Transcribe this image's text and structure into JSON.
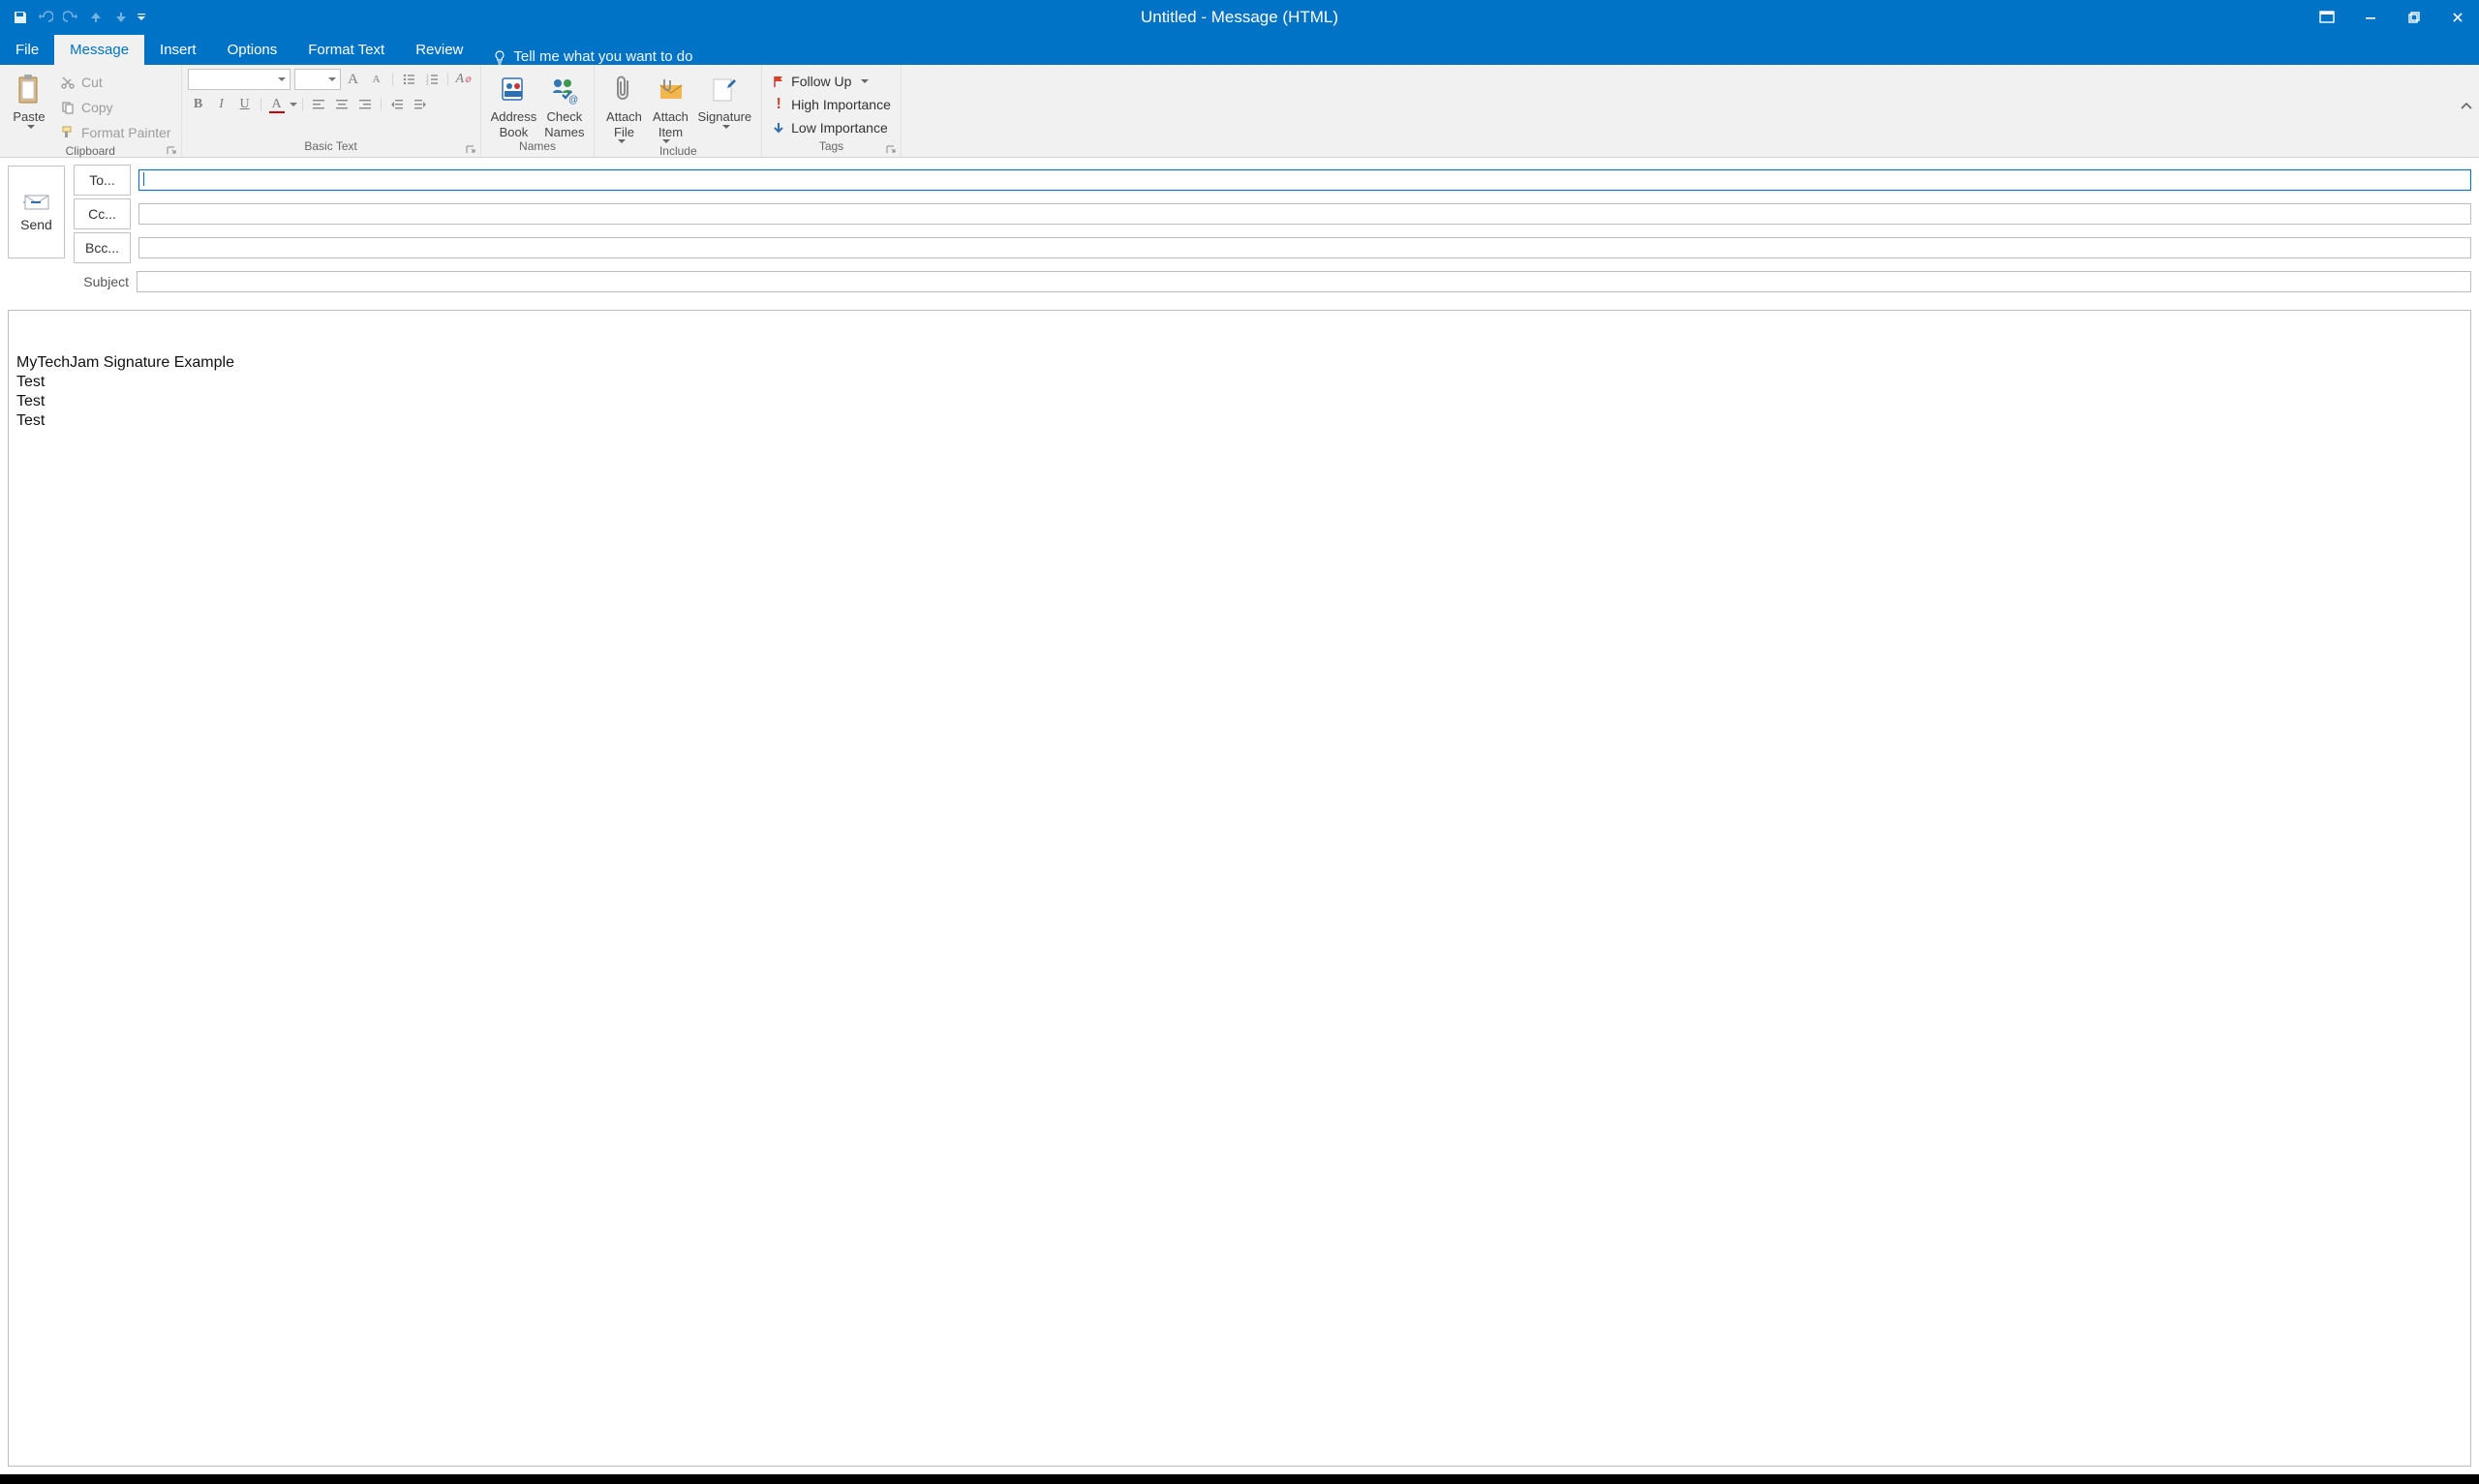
{
  "window": {
    "title": "Untitled - Message (HTML)"
  },
  "tabs": {
    "file": "File",
    "message": "Message",
    "insert": "Insert",
    "options": "Options",
    "format_text": "Format Text",
    "review": "Review",
    "tell_me": "Tell me what you want to do"
  },
  "ribbon": {
    "clipboard": {
      "label": "Clipboard",
      "paste": "Paste",
      "cut": "Cut",
      "copy": "Copy",
      "format_painter": "Format Painter"
    },
    "basic_text": {
      "label": "Basic Text"
    },
    "names": {
      "label": "Names",
      "address_book_l1": "Address",
      "address_book_l2": "Book",
      "check_names_l1": "Check",
      "check_names_l2": "Names"
    },
    "include": {
      "label": "Include",
      "attach_file_l1": "Attach",
      "attach_file_l2": "File",
      "attach_item_l1": "Attach",
      "attach_item_l2": "Item",
      "signature_l1": "Signature"
    },
    "tags": {
      "label": "Tags",
      "follow_up": "Follow Up",
      "high": "High Importance",
      "low": "Low Importance"
    }
  },
  "compose": {
    "send": "Send",
    "to": "To...",
    "cc": "Cc...",
    "bcc": "Bcc...",
    "subject": "Subject",
    "body_lines": [
      "MyTechJam Signature Example",
      "Test",
      "Test",
      "Test"
    ]
  }
}
